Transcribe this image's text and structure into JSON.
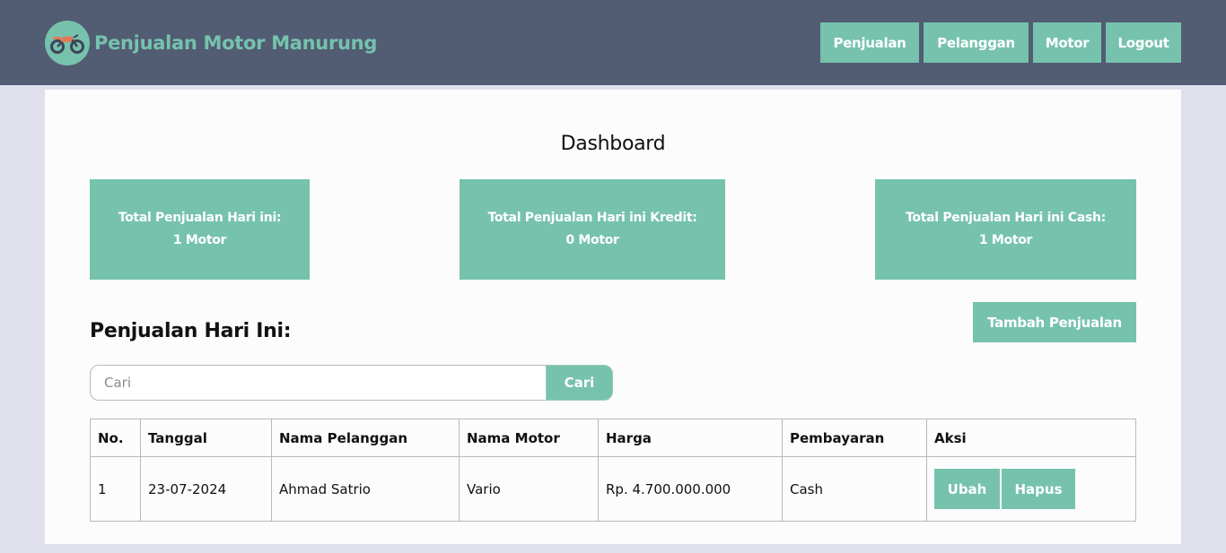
{
  "header": {
    "brand": "Penjualan Motor Manurung",
    "logo_icon": "motorcycle-icon",
    "nav": [
      {
        "label": "Penjualan"
      },
      {
        "label": "Pelanggan"
      },
      {
        "label": "Motor"
      },
      {
        "label": "Logout"
      }
    ]
  },
  "main": {
    "title": "Dashboard",
    "stats": [
      {
        "label": "Total Penjualan Hari ini:",
        "value": "1 Motor"
      },
      {
        "label": "Total Penjualan Hari ini Kredit:",
        "value": "0 Motor"
      },
      {
        "label": "Total Penjualan Hari ini Cash:",
        "value": "1 Motor"
      }
    ],
    "section_title": "Penjualan Hari Ini:",
    "add_button": "Tambah Penjualan",
    "search": {
      "placeholder": "Cari",
      "button": "Cari"
    },
    "table": {
      "headers": [
        "No.",
        "Tanggal",
        "Nama Pelanggan",
        "Nama Motor",
        "Harga",
        "Pembayaran",
        "Aksi"
      ],
      "rows": [
        {
          "no": "1",
          "tanggal": "23-07-2024",
          "pelanggan": "Ahmad Satrio",
          "motor": "Vario",
          "harga": "Rp. 4.700.000.000",
          "pembayaran": "Cash",
          "edit": "Ubah",
          "delete": "Hapus"
        }
      ]
    }
  },
  "colors": {
    "accent": "#76c2ad",
    "header_bg": "#525c73",
    "page_bg": "#dfe0ec"
  }
}
